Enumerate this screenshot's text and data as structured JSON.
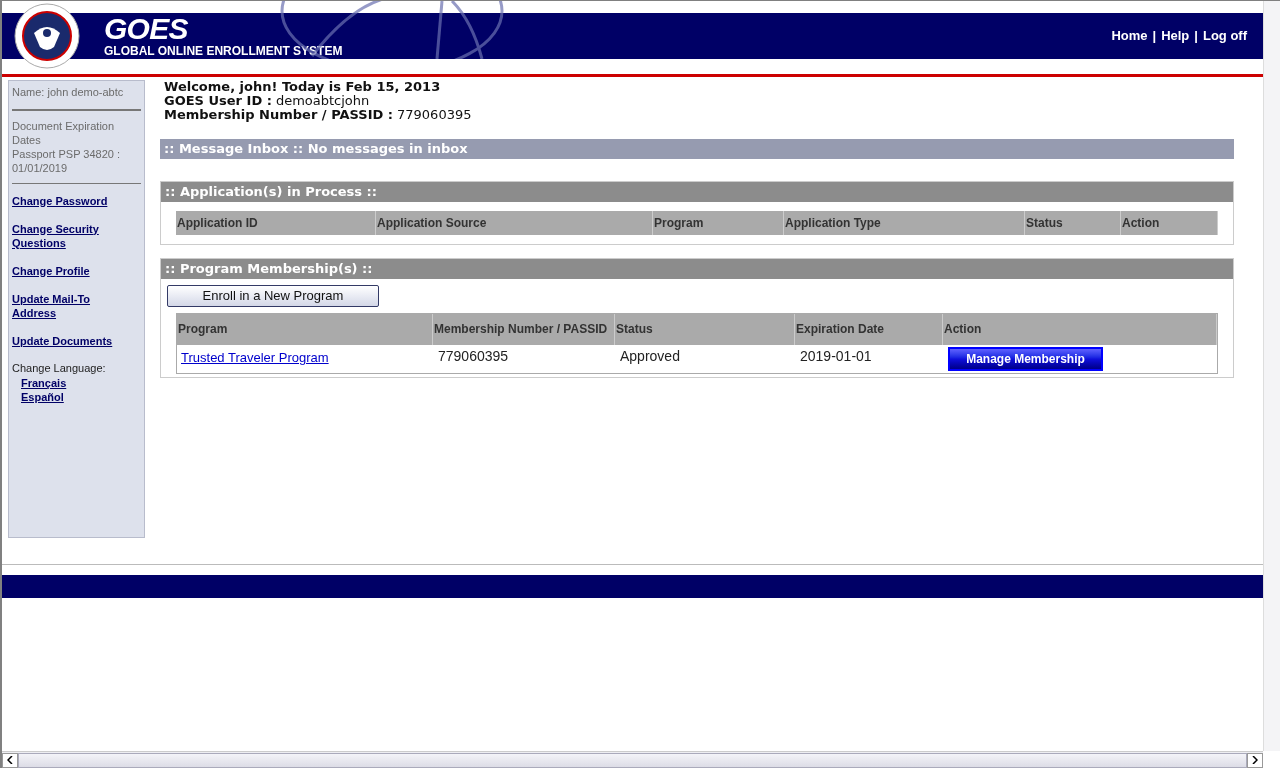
{
  "header": {
    "logo_text": "GOES",
    "logo_subtitle": "GLOBAL ONLINE ENROLLMENT SYSTEM",
    "nav": [
      "Home",
      "Help",
      "Log off"
    ],
    "nav_separator": "|"
  },
  "sidebar": {
    "name": "Name: john demo-abtc",
    "doc_lines": [
      "Document Expiration Dates",
      "Passport PSP 34820 :",
      "01/01/2019"
    ],
    "links": [
      "Change Password",
      "Change Security Questions",
      "Change Profile",
      "Update Mail-To Address",
      "Update Documents"
    ],
    "language_label": "Change Language:",
    "languages": [
      "Français",
      "Español"
    ]
  },
  "welcome": {
    "line": "Welcome, john! Today is Feb 15, 2013",
    "user_id_label": "GOES User ID :",
    "user_id": "demoabtcjohn",
    "membership_label": "Membership Number / PASSID :",
    "membership": "779060395"
  },
  "message_inbox": {
    "title": ":: Message Inbox :: No messages in inbox"
  },
  "applications": {
    "title": ":: Application(s) in Process ::",
    "columns": [
      "Application ID",
      "Application Source",
      "Program",
      "Application Type",
      "Status",
      "Action"
    ]
  },
  "memberships": {
    "title": ":: Program Membership(s) ::",
    "enroll_button": "Enroll in a New Program",
    "columns": [
      "Program",
      "Membership Number / PASSID",
      "Status",
      "Expiration Date",
      "Action"
    ],
    "rows": [
      {
        "program": "Trusted Traveler Program",
        "number": "779060395",
        "status": "Approved",
        "expiration": "2019-01-01",
        "action": "Manage Membership"
      }
    ]
  }
}
